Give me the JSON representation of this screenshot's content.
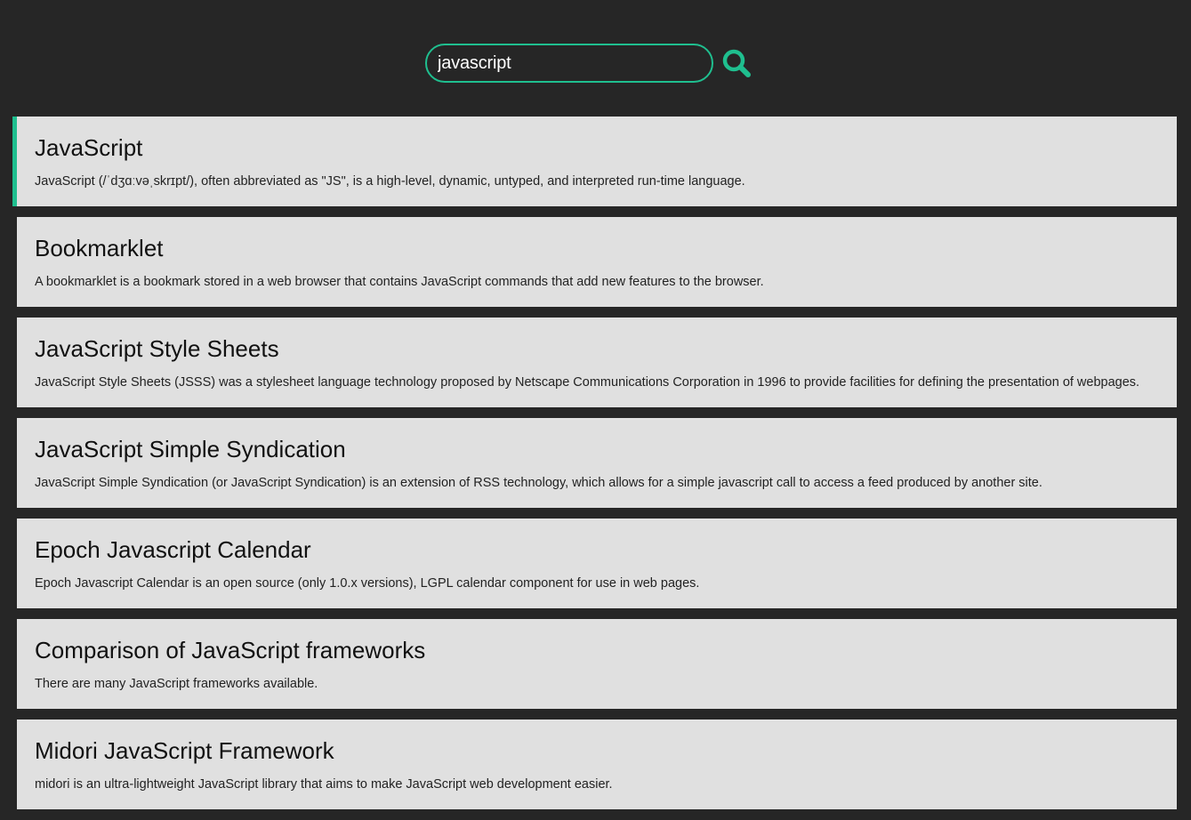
{
  "search": {
    "value": "javascript",
    "button_icon": "search-icon"
  },
  "colors": {
    "background": "#262626",
    "accent": "#1fbf8f",
    "card": "#e0e0e0"
  },
  "results": [
    {
      "title": "JavaScript",
      "snippet": "JavaScript (/ˈdʒɑːvəˌskrɪpt/), often abbreviated as \"JS\", is a high-level, dynamic, untyped, and interpreted run-time language.",
      "active": true
    },
    {
      "title": "Bookmarklet",
      "snippet": "A bookmarklet is a bookmark stored in a web browser that contains JavaScript commands that add new features to the browser.",
      "active": false
    },
    {
      "title": "JavaScript Style Sheets",
      "snippet": "JavaScript Style Sheets (JSSS) was a stylesheet language technology proposed by Netscape Communications Corporation in 1996 to provide facilities for defining the presentation of webpages.",
      "active": false
    },
    {
      "title": "JavaScript Simple Syndication",
      "snippet": "JavaScript Simple Syndication (or JavaScript Syndication) is an extension of RSS technology, which allows for a simple javascript call to access a feed produced by another site.",
      "active": false
    },
    {
      "title": "Epoch Javascript Calendar",
      "snippet": "Epoch Javascript Calendar is an open source (only 1.0.x versions), LGPL calendar component for use in web pages.",
      "active": false
    },
    {
      "title": "Comparison of JavaScript frameworks",
      "snippet": "There are many JavaScript frameworks available.",
      "active": false
    },
    {
      "title": "Midori JavaScript Framework",
      "snippet": "midori is an ultra-lightweight JavaScript library that aims to make JavaScript web development easier.",
      "active": false
    }
  ]
}
